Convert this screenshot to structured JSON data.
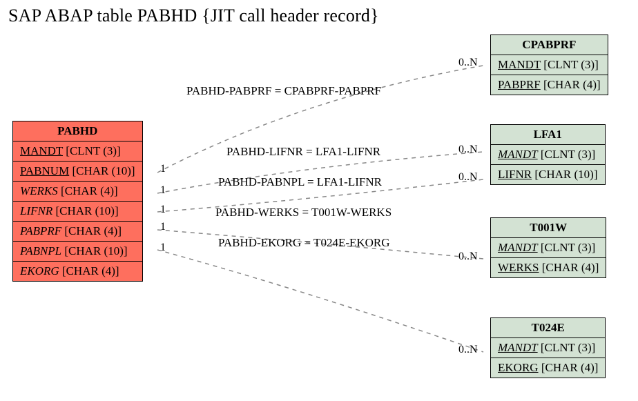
{
  "title": "SAP ABAP table PABHD {JIT call header record}",
  "main_table": {
    "name": "PABHD",
    "fields": [
      {
        "name": "MANDT",
        "type": "[CLNT (3)]",
        "key": true,
        "fk": false
      },
      {
        "name": "PABNUM",
        "type": "[CHAR (10)]",
        "key": true,
        "fk": false
      },
      {
        "name": "WERKS",
        "type": "[CHAR (4)]",
        "key": false,
        "fk": true
      },
      {
        "name": "LIFNR",
        "type": "[CHAR (10)]",
        "key": false,
        "fk": true
      },
      {
        "name": "PABPRF",
        "type": "[CHAR (4)]",
        "key": false,
        "fk": true
      },
      {
        "name": "PABNPL",
        "type": "[CHAR (10)]",
        "key": false,
        "fk": true
      },
      {
        "name": "EKORG",
        "type": "[CHAR (4)]",
        "key": false,
        "fk": true
      }
    ]
  },
  "ref_tables": [
    {
      "name": "CPABPRF",
      "fields": [
        {
          "name": "MANDT",
          "type": "[CLNT (3)]",
          "key": true,
          "fk": false
        },
        {
          "name": "PABPRF",
          "type": "[CHAR (4)]",
          "key": true,
          "fk": false
        }
      ]
    },
    {
      "name": "LFA1",
      "fields": [
        {
          "name": "MANDT",
          "type": "[CLNT (3)]",
          "key": true,
          "fk": true
        },
        {
          "name": "LIFNR",
          "type": "[CHAR (10)]",
          "key": true,
          "fk": false
        }
      ]
    },
    {
      "name": "T001W",
      "fields": [
        {
          "name": "MANDT",
          "type": "[CLNT (3)]",
          "key": true,
          "fk": true
        },
        {
          "name": "WERKS",
          "type": "[CHAR (4)]",
          "key": true,
          "fk": false
        }
      ]
    },
    {
      "name": "T024E",
      "fields": [
        {
          "name": "MANDT",
          "type": "[CLNT (3)]",
          "key": true,
          "fk": true
        },
        {
          "name": "EKORG",
          "type": "[CHAR (4)]",
          "key": true,
          "fk": false
        }
      ]
    }
  ],
  "relations": [
    {
      "label": "PABHD-PABPRF = CPABPRF-PABPRF",
      "left_card": "1",
      "right_card": "0..N"
    },
    {
      "label": "PABHD-LIFNR = LFA1-LIFNR",
      "left_card": "1",
      "right_card": "0..N"
    },
    {
      "label": "PABHD-PABNPL = LFA1-LIFNR",
      "left_card": "1",
      "right_card": "0..N"
    },
    {
      "label": "PABHD-WERKS = T001W-WERKS",
      "left_card": "1",
      "right_card": "0..N"
    },
    {
      "label": "PABHD-EKORG = T024E-EKORG",
      "left_card": "1",
      "right_card": "0..N"
    }
  ]
}
